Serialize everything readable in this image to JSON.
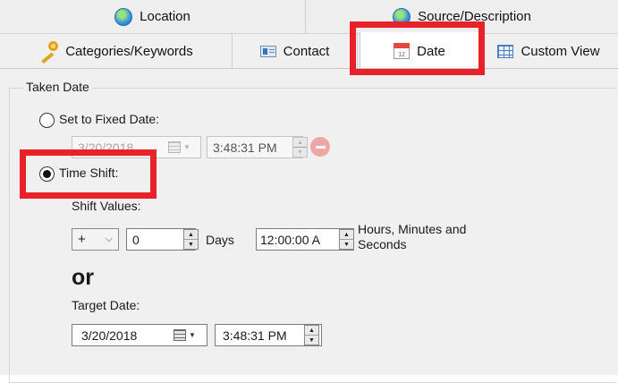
{
  "tabs": {
    "top": [
      {
        "label": "Location",
        "icon": "globe-icon"
      },
      {
        "label": "Source/Description",
        "icon": "globe-icon"
      }
    ],
    "bottom": [
      {
        "label": "Categories/Keywords",
        "icon": "key-icon"
      },
      {
        "label": "Contact",
        "icon": "contact-card-icon"
      },
      {
        "label": "Date",
        "icon": "calendar-icon",
        "active": true
      },
      {
        "label": "Custom View",
        "icon": "grid-view-icon"
      }
    ],
    "calendar_icon_text": "12"
  },
  "taken_date": {
    "group_label": "Taken Date",
    "fixed": {
      "label": "Set to Fixed Date:",
      "selected": false,
      "date_value": "3/20/2018",
      "time_value": "3:48:31 PM"
    },
    "time_shift": {
      "label": "Time Shift:",
      "selected": true,
      "shift_values_label": "Shift Values:",
      "sign": "+",
      "days_value": "0",
      "days_label": "Days",
      "hms_value": "12:00:00 A",
      "hms_label_line1": "Hours, Minutes and",
      "hms_label_line2": "Seconds",
      "or_text": "or",
      "target_date_label": "Target Date:",
      "target_date_value": "3/20/2018",
      "target_time_value": "3:48:31 PM"
    }
  },
  "colors": {
    "highlight": "#e9212a",
    "panel": "#f0f0f0"
  }
}
